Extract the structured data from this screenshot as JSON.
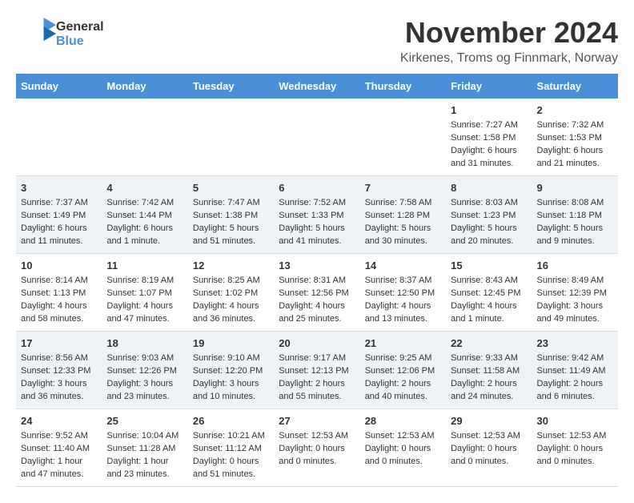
{
  "logo": {
    "text_general": "General",
    "text_blue": "Blue"
  },
  "title": "November 2024",
  "subtitle": "Kirkenes, Troms og Finnmark, Norway",
  "headers": [
    "Sunday",
    "Monday",
    "Tuesday",
    "Wednesday",
    "Thursday",
    "Friday",
    "Saturday"
  ],
  "rows": [
    [
      {
        "day": "",
        "info": ""
      },
      {
        "day": "",
        "info": ""
      },
      {
        "day": "",
        "info": ""
      },
      {
        "day": "",
        "info": ""
      },
      {
        "day": "",
        "info": ""
      },
      {
        "day": "1",
        "info": "Sunrise: 7:27 AM\nSunset: 1:58 PM\nDaylight: 6 hours and 31 minutes."
      },
      {
        "day": "2",
        "info": "Sunrise: 7:32 AM\nSunset: 1:53 PM\nDaylight: 6 hours and 21 minutes."
      }
    ],
    [
      {
        "day": "3",
        "info": "Sunrise: 7:37 AM\nSunset: 1:49 PM\nDaylight: 6 hours and 11 minutes."
      },
      {
        "day": "4",
        "info": "Sunrise: 7:42 AM\nSunset: 1:44 PM\nDaylight: 6 hours and 1 minute."
      },
      {
        "day": "5",
        "info": "Sunrise: 7:47 AM\nSunset: 1:38 PM\nDaylight: 5 hours and 51 minutes."
      },
      {
        "day": "6",
        "info": "Sunrise: 7:52 AM\nSunset: 1:33 PM\nDaylight: 5 hours and 41 minutes."
      },
      {
        "day": "7",
        "info": "Sunrise: 7:58 AM\nSunset: 1:28 PM\nDaylight: 5 hours and 30 minutes."
      },
      {
        "day": "8",
        "info": "Sunrise: 8:03 AM\nSunset: 1:23 PM\nDaylight: 5 hours and 20 minutes."
      },
      {
        "day": "9",
        "info": "Sunrise: 8:08 AM\nSunset: 1:18 PM\nDaylight: 5 hours and 9 minutes."
      }
    ],
    [
      {
        "day": "10",
        "info": "Sunrise: 8:14 AM\nSunset: 1:13 PM\nDaylight: 4 hours and 58 minutes."
      },
      {
        "day": "11",
        "info": "Sunrise: 8:19 AM\nSunset: 1:07 PM\nDaylight: 4 hours and 47 minutes."
      },
      {
        "day": "12",
        "info": "Sunrise: 8:25 AM\nSunset: 1:02 PM\nDaylight: 4 hours and 36 minutes."
      },
      {
        "day": "13",
        "info": "Sunrise: 8:31 AM\nSunset: 12:56 PM\nDaylight: 4 hours and 25 minutes."
      },
      {
        "day": "14",
        "info": "Sunrise: 8:37 AM\nSunset: 12:50 PM\nDaylight: 4 hours and 13 minutes."
      },
      {
        "day": "15",
        "info": "Sunrise: 8:43 AM\nSunset: 12:45 PM\nDaylight: 4 hours and 1 minute."
      },
      {
        "day": "16",
        "info": "Sunrise: 8:49 AM\nSunset: 12:39 PM\nDaylight: 3 hours and 49 minutes."
      }
    ],
    [
      {
        "day": "17",
        "info": "Sunrise: 8:56 AM\nSunset: 12:33 PM\nDaylight: 3 hours and 36 minutes."
      },
      {
        "day": "18",
        "info": "Sunrise: 9:03 AM\nSunset: 12:26 PM\nDaylight: 3 hours and 23 minutes."
      },
      {
        "day": "19",
        "info": "Sunrise: 9:10 AM\nSunset: 12:20 PM\nDaylight: 3 hours and 10 minutes."
      },
      {
        "day": "20",
        "info": "Sunrise: 9:17 AM\nSunset: 12:13 PM\nDaylight: 2 hours and 55 minutes."
      },
      {
        "day": "21",
        "info": "Sunrise: 9:25 AM\nSunset: 12:06 PM\nDaylight: 2 hours and 40 minutes."
      },
      {
        "day": "22",
        "info": "Sunrise: 9:33 AM\nSunset: 11:58 AM\nDaylight: 2 hours and 24 minutes."
      },
      {
        "day": "23",
        "info": "Sunrise: 9:42 AM\nSunset: 11:49 AM\nDaylight: 2 hours and 6 minutes."
      }
    ],
    [
      {
        "day": "24",
        "info": "Sunrise: 9:52 AM\nSunset: 11:40 AM\nDaylight: 1 hour and 47 minutes."
      },
      {
        "day": "25",
        "info": "Sunrise: 10:04 AM\nSunset: 11:28 AM\nDaylight: 1 hour and 23 minutes."
      },
      {
        "day": "26",
        "info": "Sunrise: 10:21 AM\nSunset: 11:12 AM\nDaylight: 0 hours and 51 minutes."
      },
      {
        "day": "27",
        "info": "Sunset: 12:53 AM\nDaylight: 0 hours and 0 minutes."
      },
      {
        "day": "28",
        "info": "Sunset: 12:53 AM\nDaylight: 0 hours and 0 minutes."
      },
      {
        "day": "29",
        "info": "Sunset: 12:53 AM\nDaylight: 0 hours and 0 minutes."
      },
      {
        "day": "30",
        "info": "Sunset: 12:53 AM\nDaylight: 0 hours and 0 minutes."
      }
    ]
  ]
}
